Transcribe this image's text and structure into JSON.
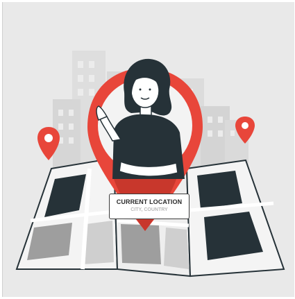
{
  "illustration": {
    "subject": "woman-in-location-pin",
    "colors": {
      "background": "#e9e9e9",
      "pin_red": "#e8463a",
      "pin_red_dark": "#c8372c",
      "building_light": "#dcdcdc",
      "building_dark": "#cfcfcf",
      "map_dark": "#263238",
      "map_light": "#f4f4f4",
      "map_grey": "#9e9e9e",
      "skin": "#ffffff",
      "hair": "#263238",
      "shirt": "#263238"
    },
    "icons": [
      "location-pin-icon",
      "location-pin-icon",
      "location-pin-icon"
    ]
  },
  "location_card": {
    "title": "CURRENT LOCATION",
    "subtitle": "CITY, COUNTRY"
  }
}
